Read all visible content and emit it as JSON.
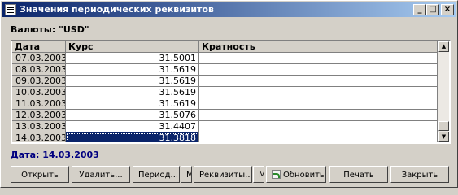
{
  "window": {
    "title": "Значения периодических реквизитов",
    "minimize_symbol": "_",
    "maximize_symbol": "□",
    "close_symbol": "×"
  },
  "currency_label": "Валюты: \"USD\"",
  "grid": {
    "columns": [
      "Дата",
      "Курс",
      "Кратность"
    ],
    "rows": [
      {
        "date": "07.03.2003",
        "rate": "31.5001",
        "mult": ""
      },
      {
        "date": "08.03.2003",
        "rate": "31.5619",
        "mult": ""
      },
      {
        "date": "09.03.2003",
        "rate": "31.5619",
        "mult": ""
      },
      {
        "date": "10.03.2003",
        "rate": "31.5619",
        "mult": ""
      },
      {
        "date": "11.03.2003",
        "rate": "31.5619",
        "mult": ""
      },
      {
        "date": "12.03.2003",
        "rate": "31.5076",
        "mult": ""
      },
      {
        "date": "13.03.2003",
        "rate": "31.4407",
        "mult": ""
      },
      {
        "date": "14.03.2003",
        "rate": "31.3818",
        "mult": ""
      }
    ],
    "selected_row": 7,
    "scroll_up_symbol": "▲",
    "scroll_down_symbol": "▼"
  },
  "status_date": "Дата: 14.03.2003",
  "buttons": {
    "open": "Открыть",
    "delete": "Удалить...",
    "period": "Период...",
    "period_menu": "M",
    "attributes": "Реквизиты...",
    "attributes_menu": "M",
    "refresh": "Обновить",
    "print": "Печать",
    "close": "Закрыть"
  }
}
